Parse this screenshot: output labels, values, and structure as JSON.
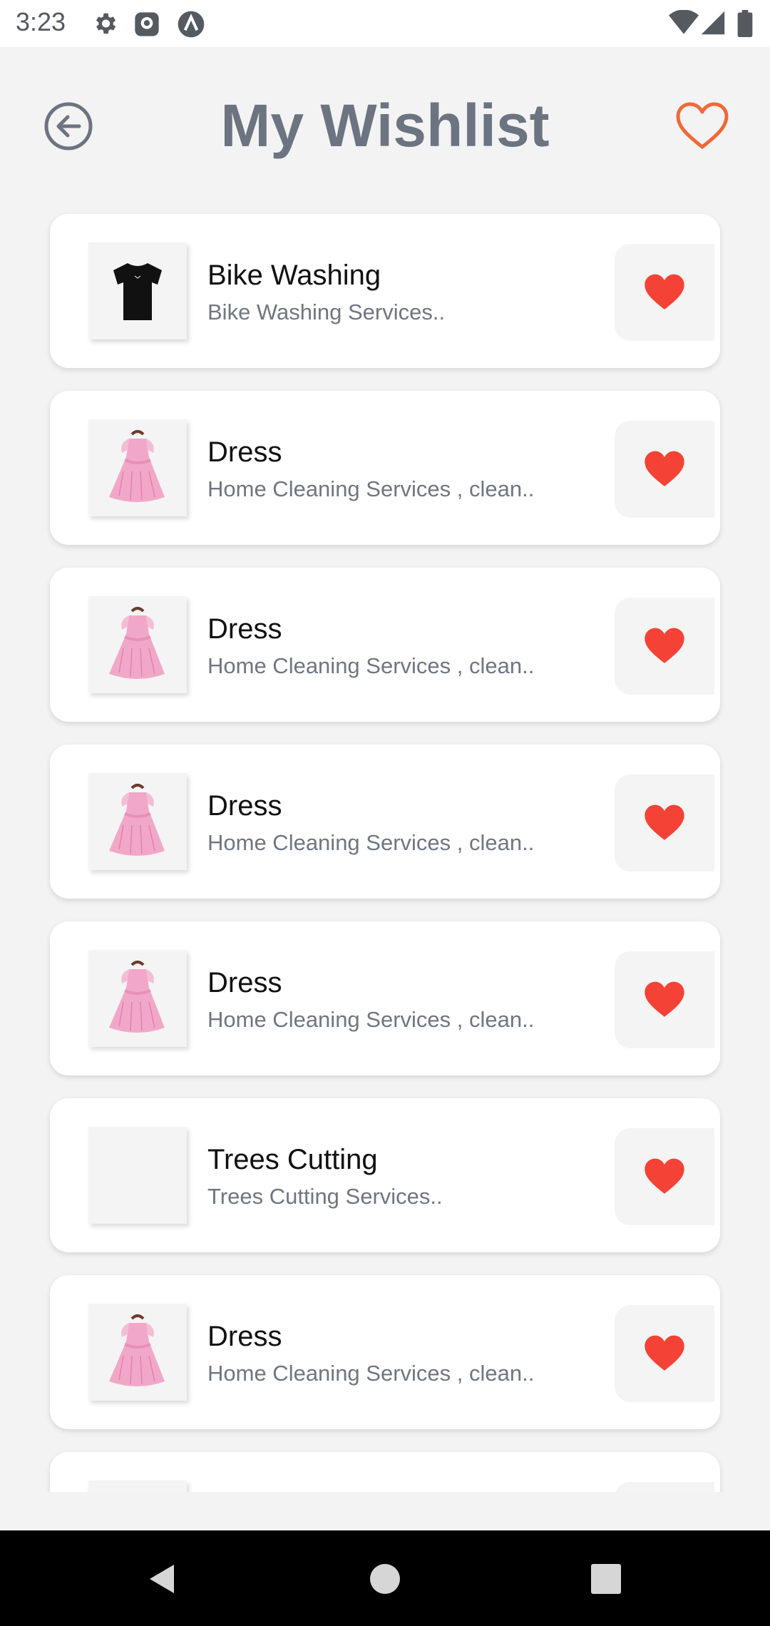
{
  "status_bar": {
    "time": "3:23",
    "icons": [
      "settings-icon",
      "app-notification-icon",
      "vpn-icon",
      "wifi-icon",
      "cell-signal-icon",
      "battery-icon"
    ]
  },
  "header": {
    "title": "My Wishlist",
    "back_icon": "back-arrow-circle-icon",
    "wishlist_icon": "heart-outline-icon"
  },
  "colors": {
    "title": "#6b7480",
    "header_heart": "#ef6a3a",
    "fav_heart": "#f44336",
    "background": "#f3f3f3",
    "card": "#ffffff"
  },
  "wishlist": {
    "items": [
      {
        "title": "Bike Washing",
        "description": "Bike Washing Services..",
        "image": "tshirt-image"
      },
      {
        "title": "Dress",
        "description": "Home Cleaning Services , clean..",
        "image": "dress-image"
      },
      {
        "title": "Dress",
        "description": "Home Cleaning Services , clean..",
        "image": "dress-image"
      },
      {
        "title": "Dress",
        "description": "Home Cleaning Services , clean..",
        "image": "dress-image"
      },
      {
        "title": "Dress",
        "description": "Home Cleaning Services , clean..",
        "image": "dress-image"
      },
      {
        "title": "Trees Cutting",
        "description": "Trees Cutting Services..",
        "image": "blank-image"
      },
      {
        "title": "Dress",
        "description": "Home Cleaning Services , clean..",
        "image": "dress-image"
      },
      {
        "title": "",
        "description": "",
        "image": "blank-image"
      }
    ]
  },
  "nav_bar": {
    "buttons": [
      "back-triangle-icon",
      "home-circle-icon",
      "recents-square-icon"
    ]
  }
}
